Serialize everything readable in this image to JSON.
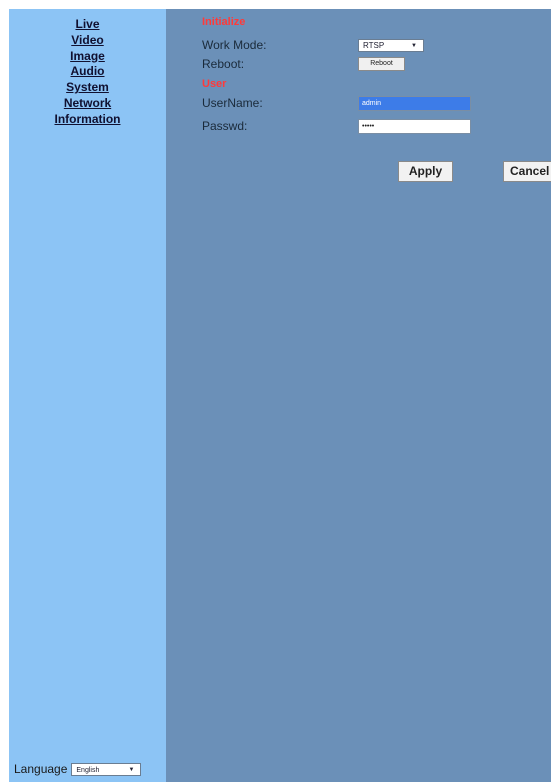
{
  "nav": {
    "items": [
      "Live",
      "Video",
      "Image",
      "Audio",
      "System",
      "Network",
      "Information"
    ]
  },
  "language": {
    "label": "Language",
    "selected": "English"
  },
  "initialize": {
    "title": "Initialize",
    "work_mode_label": "Work Mode:",
    "work_mode_value": "RTSP",
    "reboot_label": "Reboot:",
    "reboot_button": "Reboot"
  },
  "user": {
    "title": "User",
    "username_label": "UserName:",
    "username_value": "admin",
    "password_label": "Passwd:",
    "password_value": "•••••"
  },
  "actions": {
    "apply": "Apply",
    "cancel": "Cancel"
  },
  "colors": {
    "sidebar_bg": "#8cc4f5",
    "main_bg": "#6b90b8",
    "section_title": "#ff3a3a"
  }
}
